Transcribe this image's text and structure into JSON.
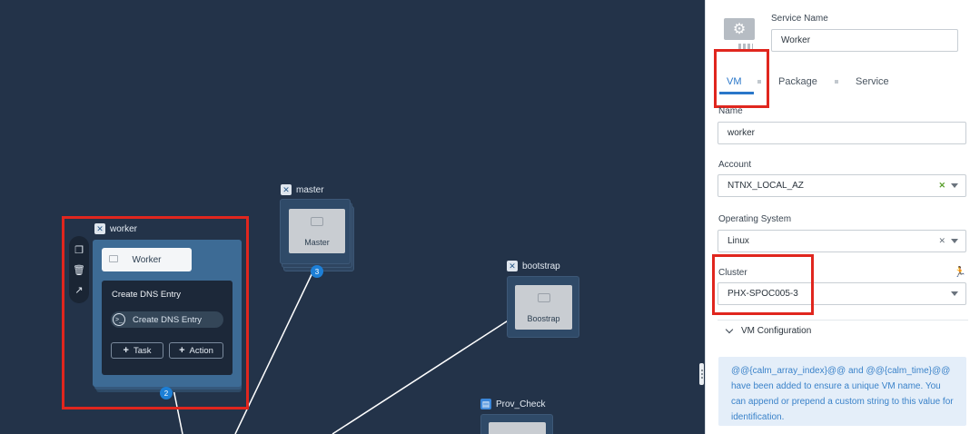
{
  "canvas": {
    "services": {
      "worker": {
        "label": "worker",
        "tile": "Worker",
        "count": "2"
      },
      "master": {
        "label": "master",
        "tile": "Master",
        "count": "3"
      },
      "bootstrap": {
        "label": "bootstrap",
        "tile": "Boostrap"
      },
      "prov_check": {
        "label": "Prov_Check"
      }
    },
    "dns_panel": {
      "title": "Create DNS Entry",
      "task_item": "Create DNS Entry",
      "task_button": "Task",
      "action_button": "Action"
    },
    "tool_strip": {
      "icons": [
        "duplicate-icon",
        "trash-icon",
        "connect-icon"
      ]
    },
    "colors": {
      "canvas_bg": "#233349",
      "selected_card": "#3d6b95",
      "highlight": "#e0261e",
      "accent": "#2a77c9"
    }
  },
  "panel": {
    "service_name_label": "Service Name",
    "service_name_value": "Worker",
    "tabs": [
      "VM",
      "Package",
      "Service"
    ],
    "active_tab": "VM",
    "name_label": "Name",
    "name_value": "worker",
    "account_label": "Account",
    "account_value": "NTNX_LOCAL_AZ",
    "os_label": "Operating System",
    "os_value": "Linux",
    "cluster_label": "Cluster",
    "cluster_value": "PHX-SPOC005-3",
    "vm_config_label": "VM Configuration",
    "info_text": "@@{calm_array_index}@@ and @@{calm_time}@@ have been added to ensure a unique VM name. You can append or prepend a custom string to this value for identification."
  }
}
